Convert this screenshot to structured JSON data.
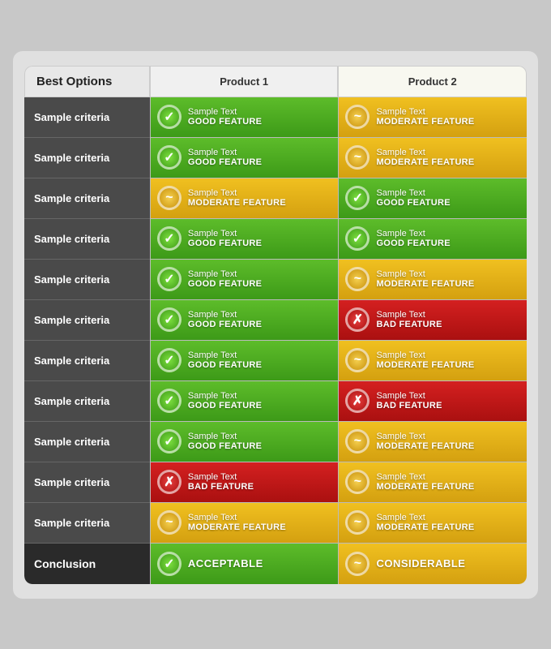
{
  "header": {
    "col1": "Best Options",
    "col2": "Product 1",
    "col3": "Product 2"
  },
  "rows": [
    {
      "criteria": "Sample criteria",
      "p1": {
        "type": "good",
        "top": "Sample Text",
        "bottom": "GOOD FEATURE",
        "icon": "✓"
      },
      "p2": {
        "type": "moderate",
        "top": "Sample Text",
        "bottom": "MODERATE FEATURE",
        "icon": "~"
      }
    },
    {
      "criteria": "Sample criteria",
      "p1": {
        "type": "good",
        "top": "Sample Text",
        "bottom": "GOOD FEATURE",
        "icon": "✓"
      },
      "p2": {
        "type": "moderate",
        "top": "Sample Text",
        "bottom": "MODERATE FEATURE",
        "icon": "~"
      }
    },
    {
      "criteria": "Sample criteria",
      "p1": {
        "type": "moderate",
        "top": "Sample Text",
        "bottom": "MODERATE FEATURE",
        "icon": "~"
      },
      "p2": {
        "type": "good",
        "top": "Sample Text",
        "bottom": "GOOD FEATURE",
        "icon": "✓"
      }
    },
    {
      "criteria": "Sample criteria",
      "p1": {
        "type": "good",
        "top": "Sample Text",
        "bottom": "GOOD FEATURE",
        "icon": "✓"
      },
      "p2": {
        "type": "good",
        "top": "Sample Text",
        "bottom": "GOOD FEATURE",
        "icon": "✓"
      }
    },
    {
      "criteria": "Sample criteria",
      "p1": {
        "type": "good",
        "top": "Sample Text",
        "bottom": "GOOD FEATURE",
        "icon": "✓"
      },
      "p2": {
        "type": "moderate",
        "top": "Sample Text",
        "bottom": "MODERATE FEATURE",
        "icon": "~"
      }
    },
    {
      "criteria": "Sample criteria",
      "p1": {
        "type": "good",
        "top": "Sample Text",
        "bottom": "GOOD FEATURE",
        "icon": "✓"
      },
      "p2": {
        "type": "bad",
        "top": "Sample Text",
        "bottom": "BAD FEATURE",
        "icon": "✗"
      }
    },
    {
      "criteria": "Sample criteria",
      "p1": {
        "type": "good",
        "top": "Sample Text",
        "bottom": "GOOD FEATURE",
        "icon": "✓"
      },
      "p2": {
        "type": "moderate",
        "top": "Sample Text",
        "bottom": "MODERATE FEATURE",
        "icon": "~"
      }
    },
    {
      "criteria": "Sample criteria",
      "p1": {
        "type": "good",
        "top": "Sample Text",
        "bottom": "GOOD FEATURE",
        "icon": "✓"
      },
      "p2": {
        "type": "bad",
        "top": "Sample Text",
        "bottom": "BAD FEATURE",
        "icon": "✗"
      }
    },
    {
      "criteria": "Sample criteria",
      "p1": {
        "type": "good",
        "top": "Sample Text",
        "bottom": "GOOD FEATURE",
        "icon": "✓"
      },
      "p2": {
        "type": "moderate",
        "top": "Sample Text",
        "bottom": "MODERATE FEATURE",
        "icon": "~"
      }
    },
    {
      "criteria": "Sample criteria",
      "p1": {
        "type": "bad",
        "top": "Sample Text",
        "bottom": "BAD FEATURE",
        "icon": "✗"
      },
      "p2": {
        "type": "moderate",
        "top": "Sample Text",
        "bottom": "MODERATE FEATURE",
        "icon": "~"
      }
    },
    {
      "criteria": "Sample criteria",
      "p1": {
        "type": "moderate",
        "top": "Sample Text",
        "bottom": "MODERATE FEATURE",
        "icon": "~"
      },
      "p2": {
        "type": "moderate",
        "top": "Sample Text",
        "bottom": "MODERATE FEATURE",
        "icon": "~"
      }
    }
  ],
  "conclusion": {
    "label": "Conclusion",
    "p1": {
      "type": "good",
      "text": "ACCEPTABLE",
      "icon": "✓"
    },
    "p2": {
      "type": "moderate",
      "text": "CONSIDERABLE",
      "icon": "~"
    }
  }
}
